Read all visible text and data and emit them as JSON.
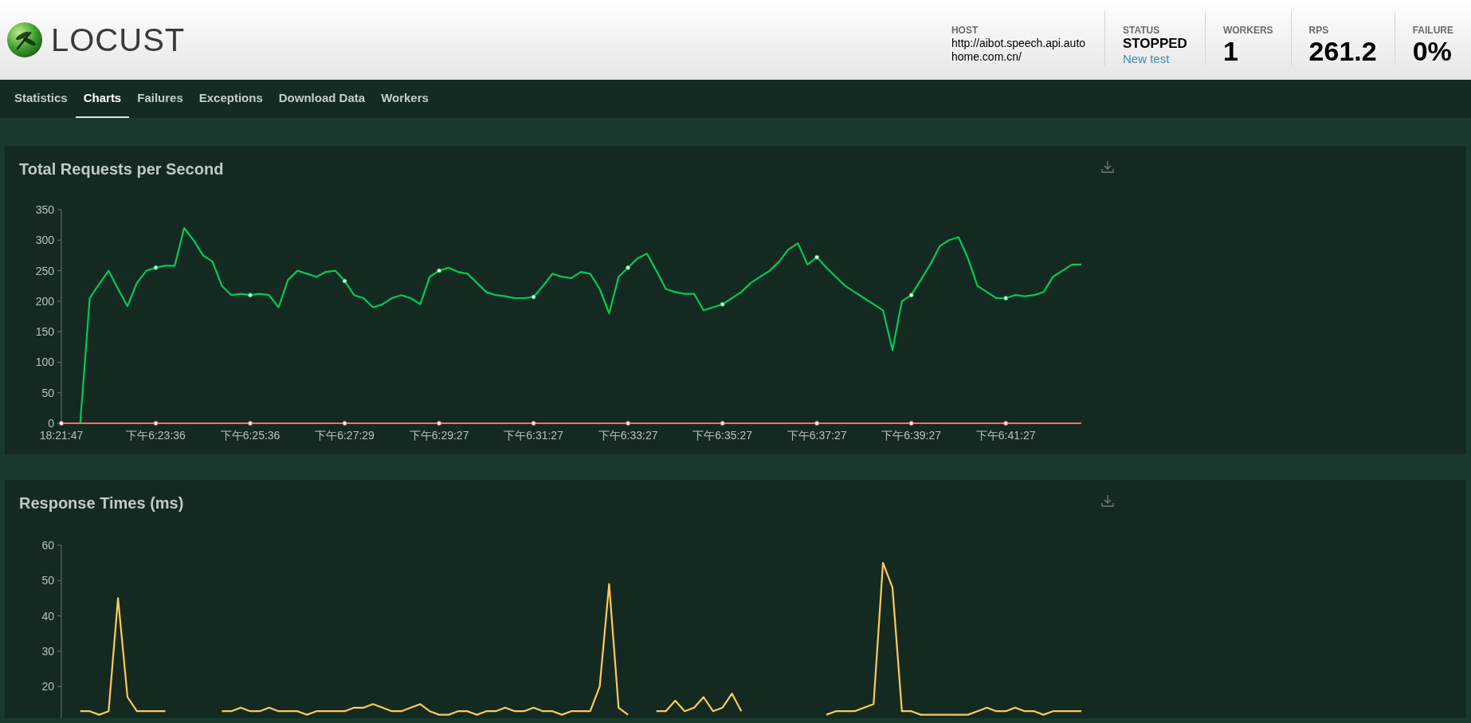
{
  "header": {
    "logo_text": "LOCUST",
    "stats": [
      {
        "kind": "host",
        "label": "HOST",
        "value": "http://aibot.speech.api.autohome.com.cn/"
      },
      {
        "kind": "status",
        "label": "STATUS",
        "value": "STOPPED",
        "link": "New test"
      },
      {
        "kind": "big",
        "label": "WORKERS",
        "value": "1"
      },
      {
        "kind": "big",
        "label": "RPS",
        "value": "261.2"
      },
      {
        "kind": "big",
        "label": "FAILURE",
        "value": "0%"
      }
    ]
  },
  "tabs": [
    {
      "label": "Statistics",
      "selected": false
    },
    {
      "label": "Charts",
      "selected": true
    },
    {
      "label": "Failures",
      "selected": false
    },
    {
      "label": "Exceptions",
      "selected": false
    },
    {
      "label": "Download Data",
      "selected": false
    },
    {
      "label": "Workers",
      "selected": false
    }
  ],
  "charts": [
    {
      "chart_data": {
        "type": "line",
        "title": "Total Requests per Second",
        "ylim": [
          0,
          350
        ],
        "yticks": [
          0,
          50,
          100,
          150,
          200,
          250,
          300,
          350
        ],
        "categories": [
          "18:21:47",
          null,
          null,
          null,
          null,
          null,
          null,
          null,
          null,
          null,
          "下午6:23:36",
          null,
          null,
          null,
          null,
          null,
          null,
          null,
          null,
          null,
          "下午6:25:36",
          null,
          null,
          null,
          null,
          null,
          null,
          null,
          null,
          null,
          "下午6:27:29",
          null,
          null,
          null,
          null,
          null,
          null,
          null,
          null,
          null,
          "下午6:29:27",
          null,
          null,
          null,
          null,
          null,
          null,
          null,
          null,
          null,
          "下午6:31:27",
          null,
          null,
          null,
          null,
          null,
          null,
          null,
          null,
          null,
          "下午6:33:27",
          null,
          null,
          null,
          null,
          null,
          null,
          null,
          null,
          null,
          "下午6:35:27",
          null,
          null,
          null,
          null,
          null,
          null,
          null,
          null,
          null,
          "下午6:37:27",
          null,
          null,
          null,
          null,
          null,
          null,
          null,
          null,
          null,
          "下午6:39:27",
          null,
          null,
          null,
          null,
          null,
          null,
          null,
          null,
          null,
          "下午6:41:27",
          null,
          null,
          null,
          null,
          null,
          null,
          null,
          null
        ],
        "series": [
          {
            "color": "#00ca5a",
            "values": [
              null,
              null,
              0,
              205,
              228,
              250,
              220,
              192,
              230,
              250,
              255,
              258,
              258,
              320,
              300,
              275,
              265,
              225,
              210,
              212,
              210,
              212,
              210,
              190,
              235,
              250,
              245,
              240,
              248,
              250,
              233,
              210,
              205,
              190,
              195,
              205,
              210,
              205,
              195,
              240,
              250,
              255,
              248,
              245,
              230,
              215,
              210,
              208,
              205,
              205,
              207,
              225,
              245,
              240,
              238,
              248,
              245,
              220,
              180,
              240,
              255,
              270,
              278,
              250,
              220,
              215,
              212,
              212,
              185,
              190,
              195,
              205,
              215,
              230,
              240,
              250,
              265,
              285,
              295,
              260,
              272,
              255,
              240,
              225,
              215,
              205,
              195,
              185,
              120,
              200,
              210,
              235,
              260,
              290,
              300,
              305,
              270,
              225,
              215,
              205,
              205,
              210,
              208,
              210,
              215,
              240,
              250,
              260,
              260
            ]
          },
          {
            "color": "#ff6d6d",
            "values": [
              0,
              0,
              0,
              0,
              0,
              0,
              0,
              0,
              0,
              0,
              0,
              0,
              0,
              0,
              0,
              0,
              0,
              0,
              0,
              0,
              0,
              0,
              0,
              0,
              0,
              0,
              0,
              0,
              0,
              0,
              0,
              0,
              0,
              0,
              0,
              0,
              0,
              0,
              0,
              0,
              0,
              0,
              0,
              0,
              0,
              0,
              0,
              0,
              0,
              0,
              0,
              0,
              0,
              0,
              0,
              0,
              0,
              0,
              0,
              0,
              0,
              0,
              0,
              0,
              0,
              0,
              0,
              0,
              0,
              0,
              0,
              0,
              0,
              0,
              0,
              0,
              0,
              0,
              0,
              0,
              0,
              0,
              0,
              0,
              0,
              0,
              0,
              0,
              0,
              0,
              0,
              0,
              0,
              0,
              0,
              0,
              0,
              0,
              0,
              0,
              0,
              0,
              0,
              0,
              0,
              0,
              0,
              0,
              0
            ]
          }
        ]
      }
    },
    {
      "chart_data": {
        "type": "line",
        "title": "Response Times (ms)",
        "ylim": [
          11,
          60
        ],
        "yticks": [
          20,
          30,
          40,
          50,
          60
        ],
        "series": [
          {
            "color": "#ffca5a",
            "values": [
              null,
              null,
              13,
              13,
              12,
              13,
              45,
              17,
              13,
              13,
              13,
              13,
              null,
              null,
              null,
              null,
              null,
              13,
              13,
              14,
              13,
              13,
              14,
              13,
              13,
              13,
              12,
              13,
              13,
              13,
              13,
              14,
              14,
              15,
              14,
              13,
              13,
              14,
              15,
              13,
              12,
              12,
              13,
              13,
              12,
              13,
              13,
              14,
              13,
              13,
              14,
              13,
              13,
              12,
              13,
              13,
              13,
              20,
              49,
              14,
              12,
              null,
              null,
              13,
              13,
              16,
              13,
              14,
              17,
              13,
              14,
              18,
              13,
              null,
              null,
              null,
              null,
              null,
              null,
              null,
              null,
              12,
              13,
              13,
              13,
              14,
              15,
              55,
              48,
              13,
              13,
              12,
              12,
              12,
              12,
              12,
              12,
              13,
              14,
              13,
              13,
              14,
              13,
              13,
              12,
              13,
              13,
              13,
              13
            ]
          }
        ]
      }
    }
  ]
}
